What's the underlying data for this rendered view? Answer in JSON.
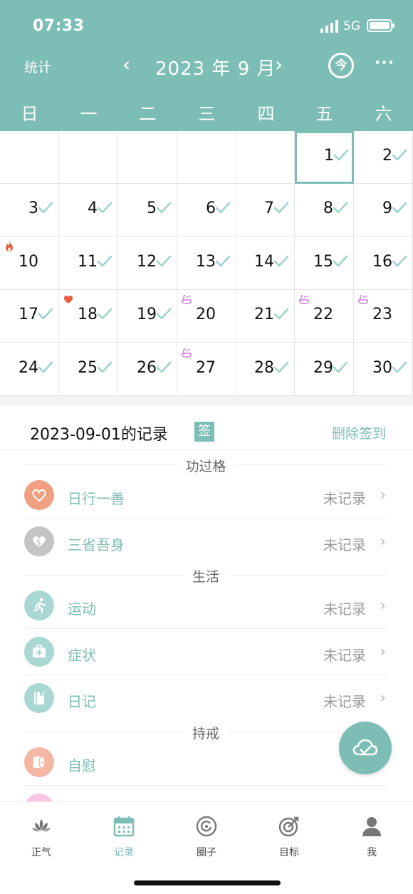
{
  "status": {
    "time": "07:33",
    "network": "5G"
  },
  "nav": {
    "left_label": "统计",
    "prev": "‹",
    "title": "2023 年 9 月",
    "next": "›",
    "today_label": "今",
    "more": "···"
  },
  "weekdays": [
    "日",
    "一",
    "二",
    "三",
    "四",
    "五",
    "六"
  ],
  "calendar": {
    "days": [
      {
        "n": "1",
        "checked": true,
        "selected": true
      },
      {
        "n": "2",
        "checked": true
      },
      {
        "n": "3",
        "checked": true
      },
      {
        "n": "4",
        "checked": true
      },
      {
        "n": "5",
        "checked": true
      },
      {
        "n": "6",
        "checked": true
      },
      {
        "n": "7",
        "checked": true
      },
      {
        "n": "8",
        "checked": true
      },
      {
        "n": "9",
        "checked": true
      },
      {
        "n": "10",
        "checked": false,
        "badge": "fire"
      },
      {
        "n": "11",
        "checked": true
      },
      {
        "n": "12",
        "checked": true
      },
      {
        "n": "13",
        "checked": true
      },
      {
        "n": "14",
        "checked": true
      },
      {
        "n": "15",
        "checked": true
      },
      {
        "n": "16",
        "checked": true
      },
      {
        "n": "17",
        "checked": true
      },
      {
        "n": "18",
        "checked": true,
        "badge": "heart"
      },
      {
        "n": "19",
        "checked": true
      },
      {
        "n": "20",
        "checked": false,
        "badge": "bath"
      },
      {
        "n": "21",
        "checked": true
      },
      {
        "n": "22",
        "checked": false,
        "badge": "bath"
      },
      {
        "n": "23",
        "checked": false,
        "badge": "bath"
      },
      {
        "n": "24",
        "checked": true
      },
      {
        "n": "25",
        "checked": true
      },
      {
        "n": "26",
        "checked": true
      },
      {
        "n": "27",
        "checked": false,
        "badge": "bath"
      },
      {
        "n": "28",
        "checked": true
      },
      {
        "n": "29",
        "checked": true
      },
      {
        "n": "30",
        "checked": true
      }
    ]
  },
  "record": {
    "title": "2023-09-01的记录",
    "sign_badge": "签",
    "delete_label": "删除签到",
    "sections": [
      {
        "title": "功过格",
        "items": [
          {
            "label": "日行一善",
            "value": "未记录",
            "icon": "heart-icon",
            "color": "#f0a080"
          },
          {
            "label": "三省吾身",
            "value": "未记录",
            "icon": "broken-heart-icon",
            "color": "#c4c4c4"
          }
        ]
      },
      {
        "title": "生活",
        "items": [
          {
            "label": "运动",
            "value": "未记录",
            "icon": "running-icon",
            "color": "#a9d8d3"
          },
          {
            "label": "症状",
            "value": "未记录",
            "icon": "medkit-icon",
            "color": "#a9d8d3"
          },
          {
            "label": "日记",
            "value": "未记录",
            "icon": "notebook-icon",
            "color": "#a9d8d3"
          }
        ]
      },
      {
        "title": "持戒",
        "items": [
          {
            "label": "自慰",
            "value": "",
            "icon": "tissue-roll-icon",
            "color": "#f6b6a4"
          }
        ]
      }
    ]
  },
  "tabs": [
    {
      "label": "正气",
      "icon": "lotus-icon"
    },
    {
      "label": "记录",
      "icon": "calendar-icon",
      "active": true
    },
    {
      "label": "圈子",
      "icon": "circle-icon"
    },
    {
      "label": "目标",
      "icon": "target-icon"
    },
    {
      "label": "我",
      "icon": "person-icon"
    }
  ],
  "colors": {
    "accent": "#7cbdb6",
    "check": "#9ed3cd",
    "fire": "#e8603c",
    "bath": "#d07ce0"
  }
}
